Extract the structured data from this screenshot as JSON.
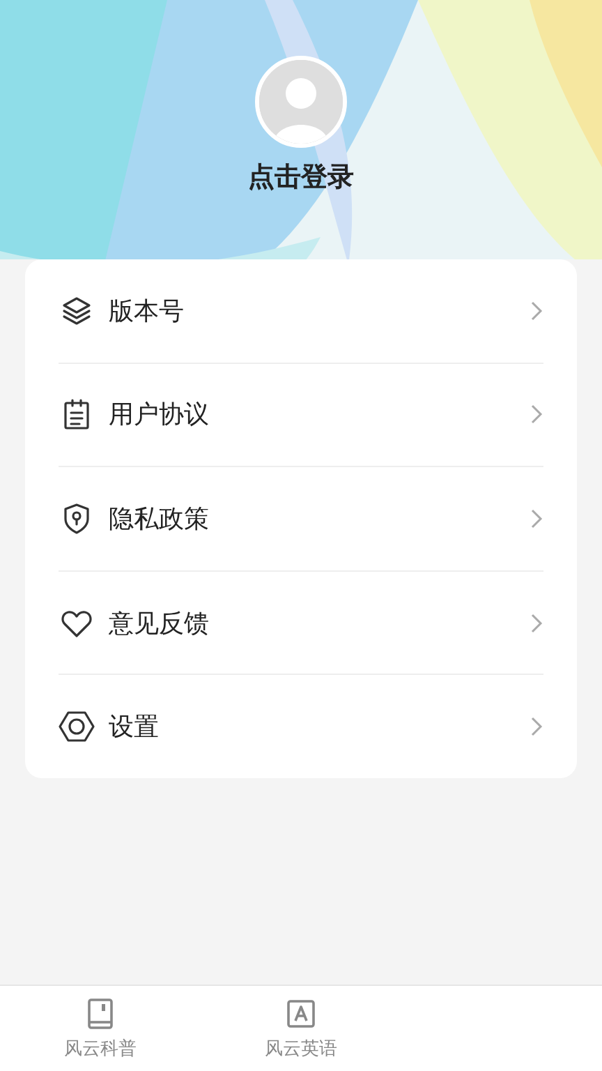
{
  "profile": {
    "login_label": "点击登录"
  },
  "menu": [
    {
      "kind": "layers",
      "label": "版本号"
    },
    {
      "kind": "clipboard",
      "label": "用户协议"
    },
    {
      "kind": "shield",
      "label": "隐私政策"
    },
    {
      "kind": "heart",
      "label": "意见反馈"
    },
    {
      "kind": "hexagon",
      "label": "设置"
    }
  ],
  "tab_bar": [
    {
      "kind": "book",
      "label": "风云科普",
      "selected": false
    },
    {
      "kind": "letter",
      "label": "风云英语",
      "selected": false
    }
  ]
}
